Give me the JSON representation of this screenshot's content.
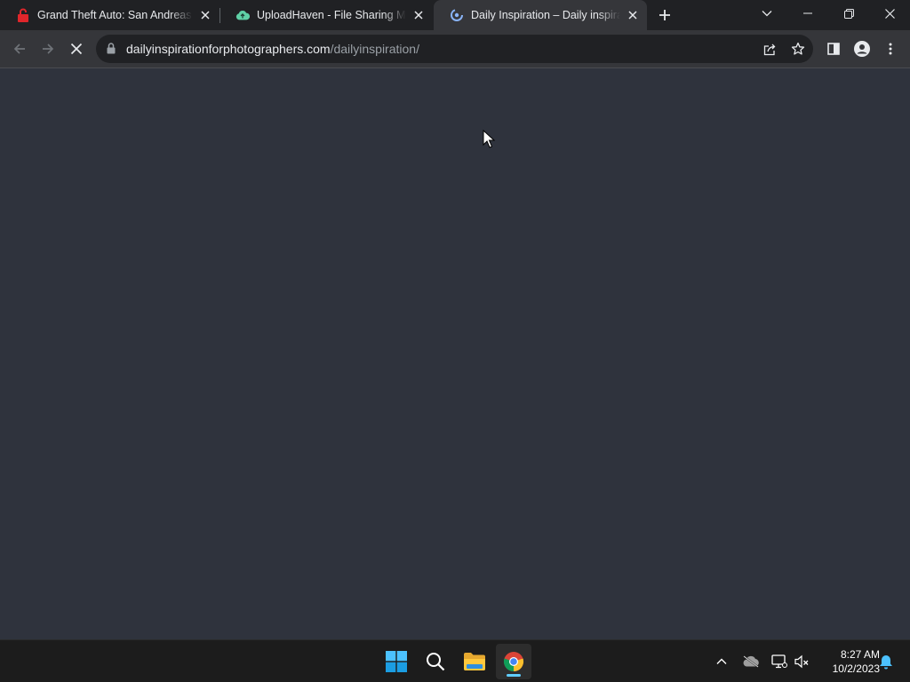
{
  "browser": {
    "tabs": [
      {
        "title": "Grand Theft Auto: San Andreas F",
        "favicon": "gta-lock-favicon-icon",
        "active": false
      },
      {
        "title": "UploadHaven - File Sharing Made",
        "favicon": "cloud-favicon-icon",
        "active": false
      },
      {
        "title": "Daily Inspiration – Daily inspiratio",
        "favicon": "loading-spinner-favicon-icon",
        "active": true
      }
    ],
    "address": {
      "domain": "dailyinspirationforphotographers.com",
      "path": "/dailyinspiration/"
    },
    "status": "loading"
  },
  "taskbar": {
    "apps": [
      "windows-start",
      "search",
      "file-explorer",
      "chrome"
    ],
    "active_app": "chrome",
    "clock": {
      "time": "8:27 AM",
      "date": "10/2/2023"
    }
  },
  "colors": {
    "tabstrip": "#202124",
    "toolbar": "#35363a",
    "page": "#2f333d",
    "taskbar": "#1c1c1c"
  }
}
